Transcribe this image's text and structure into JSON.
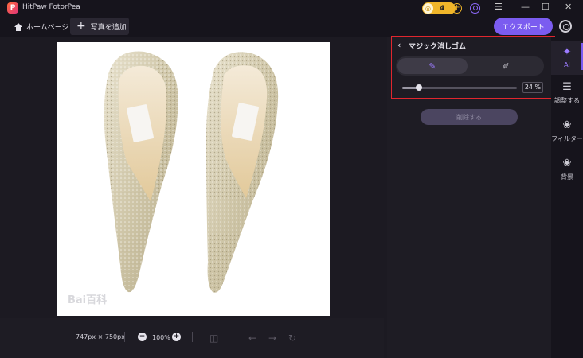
{
  "window": {
    "title": "HitPaw FotorPea"
  },
  "header": {
    "coins": "4",
    "home_label": "ホームページ",
    "add_photo_label": "写真を追加",
    "export_label": "エクスポート"
  },
  "canvas": {
    "dimensions": "747px × 750px",
    "zoom": "100%",
    "watermark": "Bai百科"
  },
  "magic_eraser": {
    "title": "マジック消しゴム",
    "brush_size_percent": 24,
    "brush_size_label": "24 %",
    "erase_label": "削除する"
  },
  "rail": {
    "items": [
      {
        "label": "AI"
      },
      {
        "label": "調整する"
      },
      {
        "label": "フィルター"
      },
      {
        "label": "背景"
      }
    ]
  },
  "colors": {
    "accent": "#7b5cf0",
    "highlight": "#e0262e"
  }
}
